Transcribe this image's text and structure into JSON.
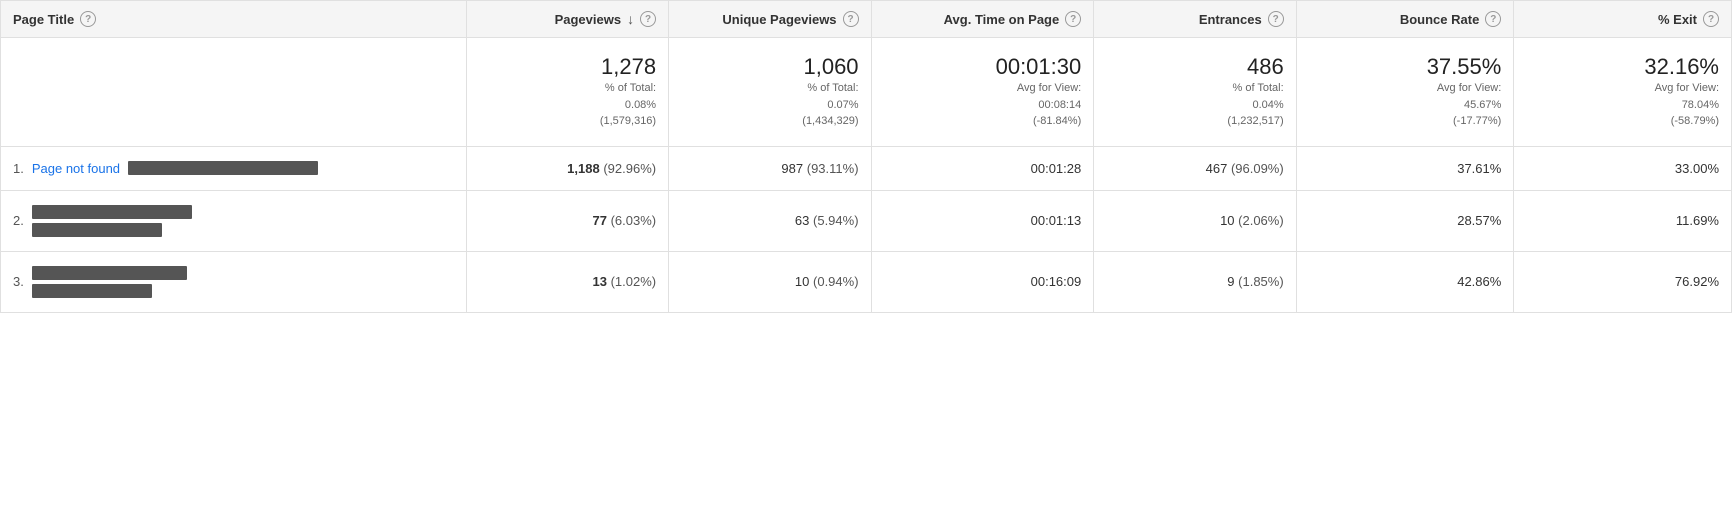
{
  "header": {
    "page_title_label": "Page Title",
    "pageviews_label": "Pageviews",
    "unique_pageviews_label": "Unique Pageviews",
    "avg_time_label": "Avg. Time on Page",
    "entrances_label": "Entrances",
    "bounce_rate_label": "Bounce Rate",
    "exit_label": "% Exit"
  },
  "totals": {
    "pageviews_main": "1,278",
    "pageviews_sub1": "% of Total:",
    "pageviews_sub2": "0.08%",
    "pageviews_sub3": "(1,579,316)",
    "unique_pageviews_main": "1,060",
    "unique_pageviews_sub1": "% of Total:",
    "unique_pageviews_sub2": "0.07%",
    "unique_pageviews_sub3": "(1,434,329)",
    "avg_time_main": "00:01:30",
    "avg_time_sub1": "Avg for View:",
    "avg_time_sub2": "00:08:14",
    "avg_time_sub3": "(-81.84%)",
    "entrances_main": "486",
    "entrances_sub1": "% of Total:",
    "entrances_sub2": "0.04%",
    "entrances_sub3": "(1,232,517)",
    "bounce_rate_main": "37.55%",
    "bounce_rate_sub1": "Avg for View:",
    "bounce_rate_sub2": "45.67%",
    "bounce_rate_sub3": "(-17.77%)",
    "exit_main": "32.16%",
    "exit_sub1": "Avg for View:",
    "exit_sub2": "78.04%",
    "exit_sub3": "(-58.79%)"
  },
  "rows": [
    {
      "num": "1.",
      "page": "Page not found",
      "bar_type": "full",
      "pageviews_bold": "1,188",
      "pageviews_pct": "(92.96%)",
      "unique_pageviews": "987",
      "unique_pct": "(93.11%)",
      "avg_time": "00:01:28",
      "entrances": "467",
      "entrances_pct": "(96.09%)",
      "bounce_rate": "37.61%",
      "exit": "33.00%"
    },
    {
      "num": "2.",
      "page": "redacted_2",
      "bar_type": "med",
      "pageviews_bold": "77",
      "pageviews_pct": "(6.03%)",
      "unique_pageviews": "63",
      "unique_pct": "(5.94%)",
      "avg_time": "00:01:13",
      "entrances": "10",
      "entrances_pct": "(2.06%)",
      "bounce_rate": "28.57%",
      "exit": "11.69%"
    },
    {
      "num": "3.",
      "page": "redacted_3",
      "bar_type": "short",
      "pageviews_bold": "13",
      "pageviews_pct": "(1.02%)",
      "unique_pageviews": "10",
      "unique_pct": "(0.94%)",
      "avg_time": "00:16:09",
      "entrances": "9",
      "entrances_pct": "(1.85%)",
      "bounce_rate": "42.86%",
      "exit": "76.92%"
    }
  ]
}
